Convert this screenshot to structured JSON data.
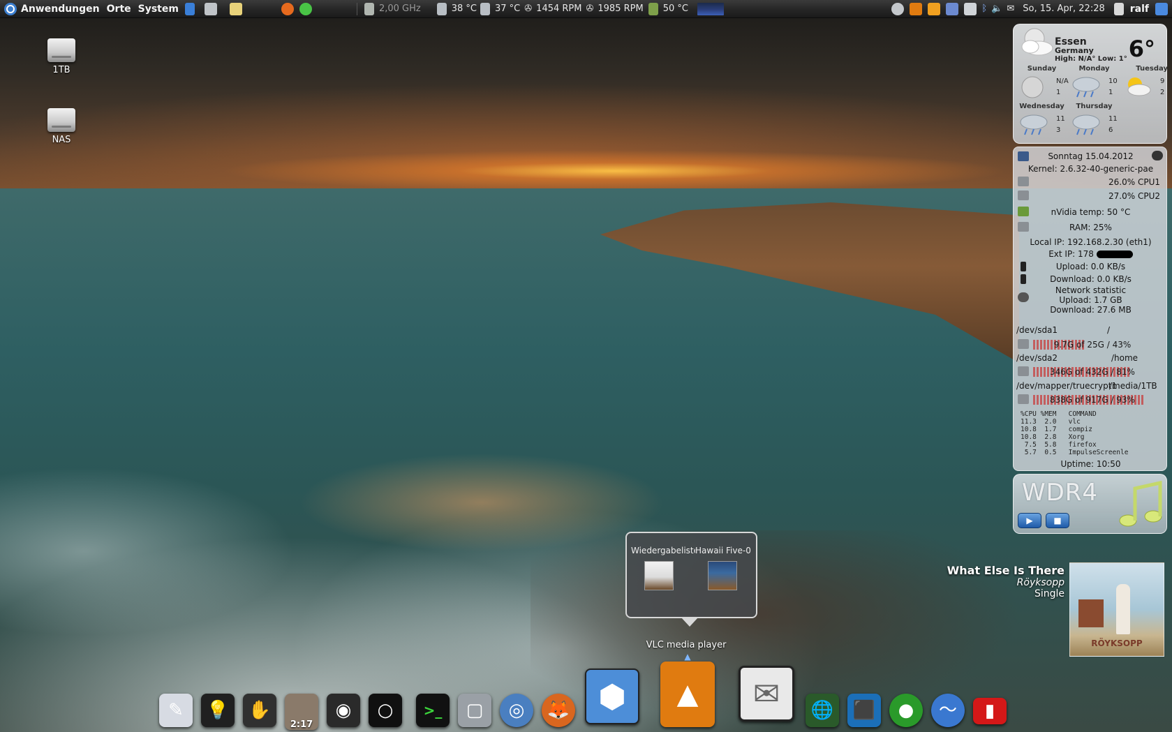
{
  "top_panel": {
    "menus": [
      "Anwendungen",
      "Orte",
      "System"
    ],
    "cpu_freq": "2,00 GHz",
    "temp1": "38 °C",
    "temp2": "37 °C",
    "fan1": "1454 RPM",
    "fan2": "1985 RPM",
    "gpu_temp": "50 °C",
    "clock": "So, 15. Apr, 22:28",
    "user": "ralf"
  },
  "desktop_icons": [
    {
      "label": "1TB",
      "icon": "hard-drive-icon"
    },
    {
      "label": "NAS",
      "icon": "hard-drive-icon"
    }
  ],
  "weather": {
    "city": "Essen",
    "country": "Germany",
    "hi_lo": "High: N/A°   Low: 1°",
    "temp": "6°",
    "current_icon": "partly-cloudy-night-icon",
    "days": [
      {
        "name": "Sunday",
        "hi": "N/A",
        "lo": "1",
        "icon": "moon-icon"
      },
      {
        "name": "Monday",
        "hi": "10",
        "lo": "1",
        "icon": "rain-cloud-icon"
      },
      {
        "name": "Tuesday",
        "hi": "9",
        "lo": "2",
        "icon": "sun-cloud-icon"
      },
      {
        "name": "Wednesday",
        "hi": "11",
        "lo": "3",
        "icon": "rain-cloud-icon"
      },
      {
        "name": "Thursday",
        "hi": "11",
        "lo": "6",
        "icon": "rain-cloud-icon"
      }
    ]
  },
  "conky": {
    "date": "Sonntag 15.04.2012",
    "kernel": "Kernel: 2.6.32-40-generic-pae",
    "cpu1": "26.0% CPU1",
    "cpu2": "27.0% CPU2",
    "nvidia": "nVidia temp: 50 °C",
    "ram": "RAM: 25%",
    "local_ip": "Local IP: 192.168.2.30 (eth1)",
    "ext_ip": "Ext IP: 178",
    "upload": "Upload: 0.0 KB/s",
    "download": "Download: 0.0 KB/s",
    "net_stat_title": "Network statistic",
    "net_stat_up": "Upload: 1.7 GB",
    "net_stat_down": "Download: 27.6 MB",
    "disks": [
      {
        "dev": "/dev/sda1",
        "mount": "/",
        "usage": "9.7G of 25G / 43%",
        "fill": 0.43
      },
      {
        "dev": "/dev/sda2",
        "mount": "/home",
        "usage": "346G of 432G / 81%",
        "fill": 0.81
      },
      {
        "dev": "/dev/mapper/truecrypt1",
        "mount": "/media/1TB",
        "usage": "838G of 917G / 93%",
        "fill": 0.93
      }
    ],
    "proc_header": "%CPU %MEM   COMMAND",
    "processes": [
      "11.3  2.0   vlc",
      "10.8  1.7   compiz",
      "10.8  2.8   Xorg",
      " 7.5  5.8   firefox",
      " 5.7  0.5   ImpulseScreenle"
    ],
    "uptime": "Uptime: 10:50"
  },
  "radio": {
    "station": "WDR4",
    "play_label": "▶",
    "stop_label": "■"
  },
  "now_playing": {
    "title": "What Else Is There",
    "artist": "Röyksopp",
    "album": "Single",
    "art_text": "RÖYKSOPP"
  },
  "vlc_popup": {
    "window1": "Wiedergabeliste",
    "window2": "Hawaii Five-0"
  },
  "dock": {
    "hover_label": "VLC media player",
    "clock_text": "2:17",
    "items": [
      {
        "name": "text-editor-icon",
        "color": "#d7dbe3",
        "glyph": "✎"
      },
      {
        "name": "lightbulb-icon",
        "color": "#202020",
        "glyph": "💡"
      },
      {
        "name": "gnome-foot-icon",
        "color": "#303030",
        "glyph": "✋"
      },
      {
        "name": "clock-photo-icon",
        "color": "#8a7a6a",
        "glyph": ""
      },
      {
        "name": "speaker-icon",
        "color": "#2a2a2a",
        "glyph": "◉"
      },
      {
        "name": "circle-app-icon",
        "color": "#101010",
        "glyph": "○"
      },
      {
        "name": "terminal-icon",
        "color": "#111111",
        "glyph": ">_"
      },
      {
        "name": "window-manager-icon",
        "color": "#9aa0a6",
        "glyph": "▢"
      },
      {
        "name": "chromium-icon",
        "color": "#4a7fc0",
        "glyph": "◎"
      },
      {
        "name": "firefox-icon",
        "color": "#d9661f",
        "glyph": "🦊"
      },
      {
        "name": "3d-cube-icon",
        "color": "#4d8ed8",
        "glyph": "⬢"
      },
      {
        "name": "vlc-icon",
        "color": "#e07b10",
        "glyph": "▲"
      },
      {
        "name": "mail-icon",
        "color": "#e9e9e9",
        "glyph": "✉"
      },
      {
        "name": "globe-search-icon",
        "color": "#2a5a2a",
        "glyph": "🌐"
      },
      {
        "name": "box-icon",
        "color": "#1b6fb8",
        "glyph": "⬛"
      },
      {
        "name": "green-orb-icon",
        "color": "#2a9a2a",
        "glyph": "●"
      },
      {
        "name": "system-monitor-icon",
        "color": "#3a78d0",
        "glyph": "〜"
      },
      {
        "name": "red-flag-icon",
        "color": "#d41818",
        "glyph": "▮"
      }
    ]
  },
  "colors": {
    "panel_bg": "#262626",
    "widget_bg": "#d7dade",
    "disk_bar": "#c83c3c",
    "vlc_orange": "#e07b10"
  }
}
